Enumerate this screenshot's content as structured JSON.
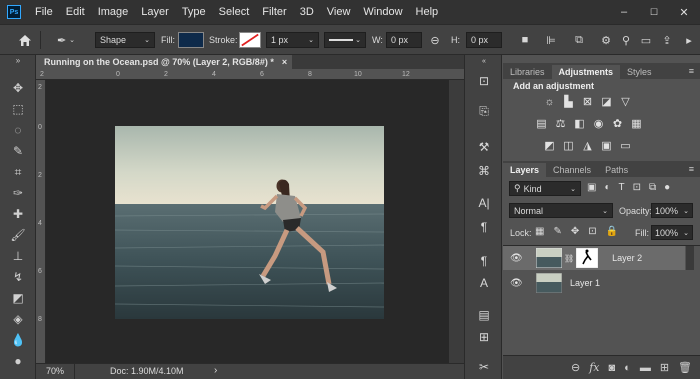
{
  "app": {
    "logo_text": "Ps"
  },
  "menu": [
    "File",
    "Edit",
    "Image",
    "Layer",
    "Type",
    "Select",
    "Filter",
    "3D",
    "View",
    "Window",
    "Help"
  ],
  "window_controls": [
    "–",
    "☐",
    "✕"
  ],
  "options_bar": {
    "mode": "Shape",
    "fill_label": "Fill:",
    "fill_color": "#0e2a4a",
    "stroke_label": "Stroke:",
    "stroke_width": "1 px",
    "w_label": "W:",
    "w_value": "0 px",
    "h_label": "H:",
    "h_value": "0 px"
  },
  "document": {
    "tab_title": "Running on the Ocean.psd @ 70% (Layer 2, RGB/8#) *",
    "close": "×",
    "zoom": "70%",
    "doc_info": "Doc: 1.90M/4.10M",
    "ruler_top": [
      "2",
      "0",
      "2",
      "4",
      "6",
      "8",
      "10",
      "12"
    ],
    "ruler_left": [
      "2",
      "0",
      "2",
      "4",
      "6",
      "8"
    ]
  },
  "adjustments_panel": {
    "tabs": [
      "Libraries",
      "Adjustments",
      "Styles"
    ],
    "active_tab": "Adjustments",
    "title": "Add an adjustment"
  },
  "layers_panel": {
    "tabs": [
      "Layers",
      "Channels",
      "Paths"
    ],
    "active_tab": "Layers",
    "filter_kind": "Kind",
    "blend_mode": "Normal",
    "opacity_label": "Opacity:",
    "opacity_value": "100%",
    "lock_label": "Lock:",
    "fill_label": "Fill:",
    "fill_value": "100%",
    "layers": [
      {
        "name": "Layer 2",
        "selected": true,
        "has_mask": true
      },
      {
        "name": "Layer 1",
        "selected": false,
        "has_mask": false
      }
    ],
    "footer_icons": [
      "link-icon",
      "fx-icon",
      "mask-icon",
      "adjustment-icon",
      "folder-icon",
      "new-layer-icon",
      "trash-icon"
    ]
  },
  "colors": {
    "menubar": "#323232",
    "panel": "#424242",
    "workspace": "#535353",
    "canvas_bg": "#282828",
    "selected_layer": "#6b6b6b"
  }
}
